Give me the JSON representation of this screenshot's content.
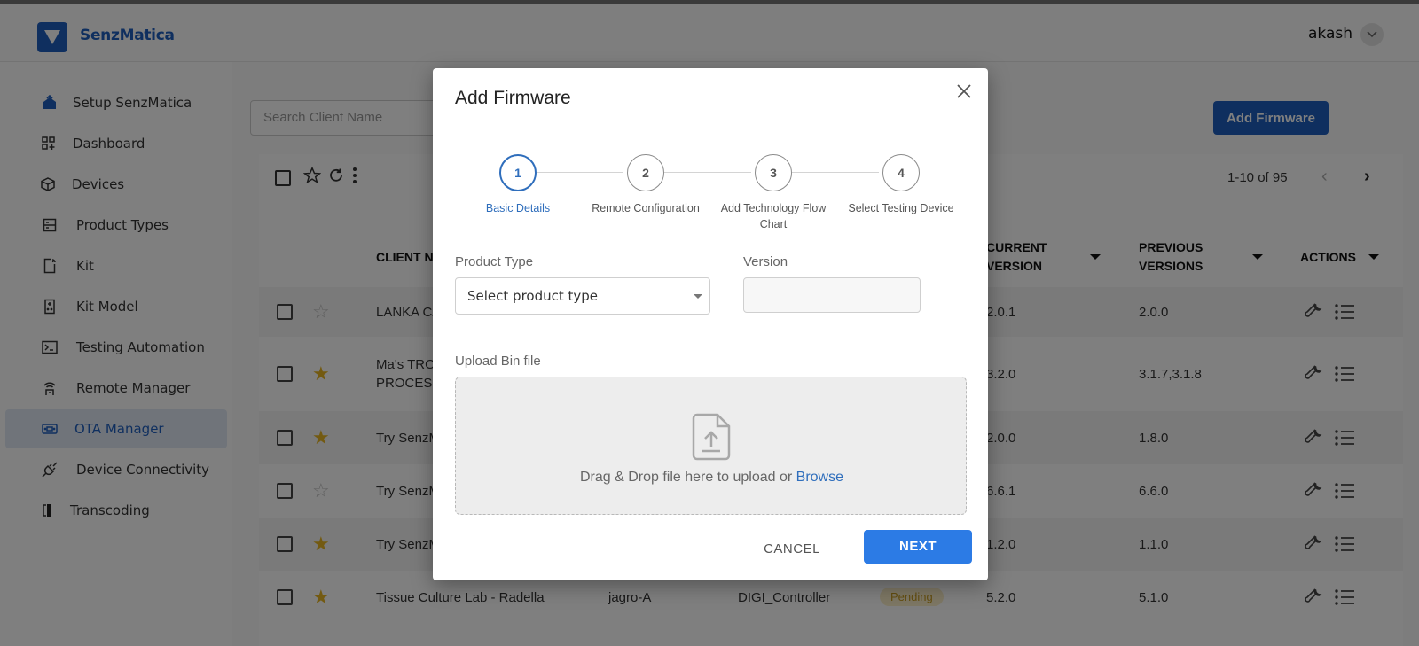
{
  "app": {
    "brand": "SenzMatica",
    "user": "akash"
  },
  "sidebar": {
    "items": [
      {
        "label": "Setup SenzMatica",
        "icon": "setup-icon",
        "active": false
      },
      {
        "label": "Dashboard",
        "icon": "dashboard-icon",
        "active": false
      },
      {
        "label": "Devices",
        "icon": "devices-cube-icon",
        "active": false
      },
      {
        "label": "Product Types",
        "icon": "product-types-icon",
        "active": false
      },
      {
        "label": "Kit",
        "icon": "kit-icon",
        "active": false
      },
      {
        "label": "Kit Model",
        "icon": "kit-model-icon",
        "active": false
      },
      {
        "label": "Testing Automation",
        "icon": "terminal-icon",
        "active": false
      },
      {
        "label": "Remote Manager",
        "icon": "remote-icon",
        "active": false
      },
      {
        "label": "OTA Manager",
        "icon": "ota-icon",
        "active": true
      },
      {
        "label": "Device Connectivity",
        "icon": "plug-icon",
        "active": false
      },
      {
        "label": "Transcoding",
        "icon": "transcoding-icon",
        "active": false
      }
    ]
  },
  "main": {
    "search_placeholder": "Search Client Name",
    "add_firmware_label": "Add Firmware",
    "pagination": "1-10 of 95",
    "columns": {
      "client_name": "CLIENT N",
      "current_version_1": "CURRENT",
      "current_version_2": "VERSION",
      "previous_versions_1": "PREVIOUS",
      "previous_versions_2": "VERSIONS",
      "actions": "ACTIONS"
    },
    "rows": [
      {
        "starred": false,
        "client_1": "LANKA CA",
        "client_2": "",
        "current": "2.0.1",
        "previous": "2.0.0"
      },
      {
        "starred": true,
        "client_1": "Ma's TRO",
        "client_2": "PROCESS",
        "current": "3.2.0",
        "previous": "3.1.7,3.1.8"
      },
      {
        "starred": true,
        "client_1": "Try SenzM",
        "client_2": "",
        "current": "2.0.0",
        "previous": "1.8.0"
      },
      {
        "starred": false,
        "client_1": "Try SenzM",
        "client_2": "",
        "current": "6.6.1",
        "previous": "6.6.0"
      },
      {
        "starred": true,
        "client_1": "Try SenzM",
        "client_2": "",
        "current": "1.2.0",
        "previous": "1.1.0"
      },
      {
        "starred": true,
        "client_1": "Tissue Culture Lab - Radella",
        "client_2": "",
        "user": "jagro-A",
        "product": "DIGI_Controller",
        "status": "Pending",
        "current": "5.2.0",
        "previous": "5.1.0"
      }
    ]
  },
  "modal": {
    "title": "Add Firmware",
    "steps": [
      {
        "number": "1",
        "label": "Basic Details",
        "active": true
      },
      {
        "number": "2",
        "label": "Remote Configuration",
        "active": false
      },
      {
        "number": "3",
        "label": "Add Technology Flow Chart",
        "active": false
      },
      {
        "number": "4",
        "label": "Select Testing Device",
        "active": false
      }
    ],
    "product_type_label": "Product Type",
    "product_type_value": "Select product type",
    "version_label": "Version",
    "version_value": "",
    "upload_label": "Upload Bin file",
    "dropzone_text": "Drag & Drop file here to upload or ",
    "dropzone_link": "Browse",
    "cancel_label": "CANCEL",
    "next_label": "NEXT"
  },
  "colors": {
    "brand_blue": "#1f5fbf",
    "step_active": "#2f6ebc",
    "next_button": "#2c7be5",
    "star_on": "#e6b422",
    "pending_badge": "#c69a1e"
  }
}
